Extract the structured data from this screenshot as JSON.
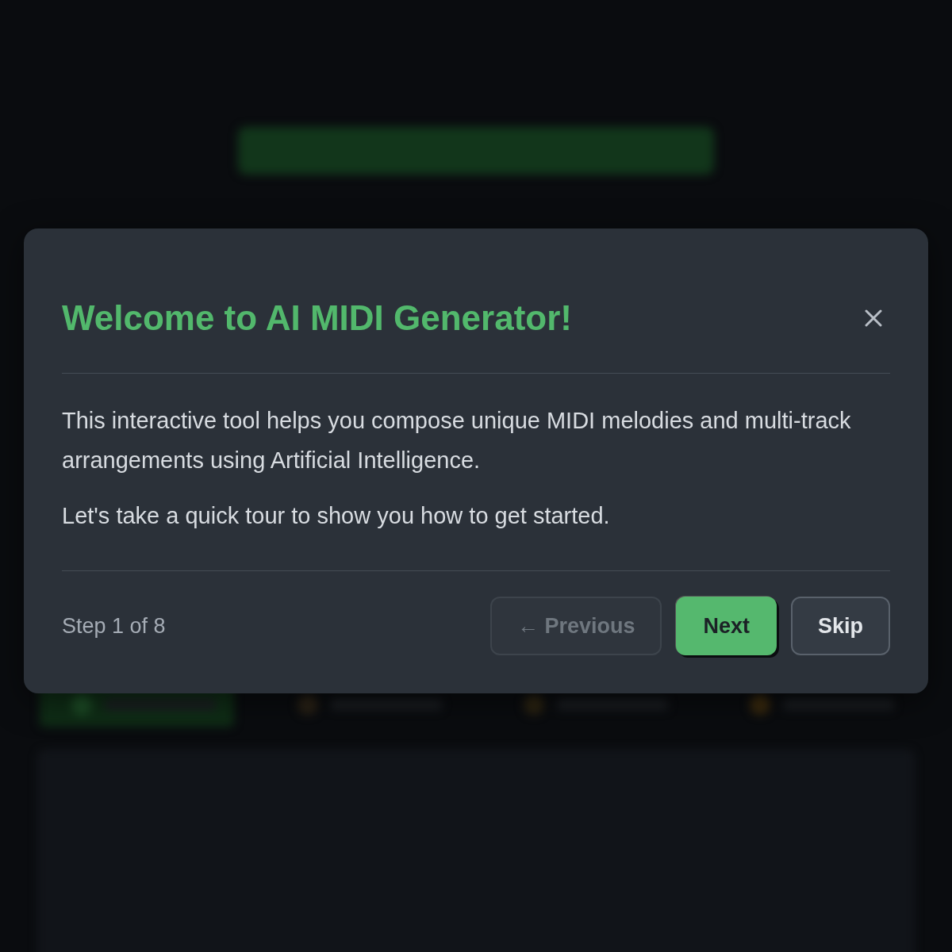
{
  "dialog": {
    "title": "Welcome to AI MIDI Generator!",
    "paragraphs": [
      "This interactive tool helps you compose unique MIDI melodies and multi-track arrangements using Artificial Intelligence.",
      "Let's take a quick tour to show you how to get started."
    ],
    "step": "Step 1 of 8",
    "buttons": [
      {
        "label": "← Previous",
        "kind": "secondary",
        "disabled": true
      },
      {
        "label": "Next",
        "kind": "primary",
        "disabled": false
      },
      {
        "label": "Skip",
        "kind": "outline",
        "disabled": false
      }
    ]
  }
}
